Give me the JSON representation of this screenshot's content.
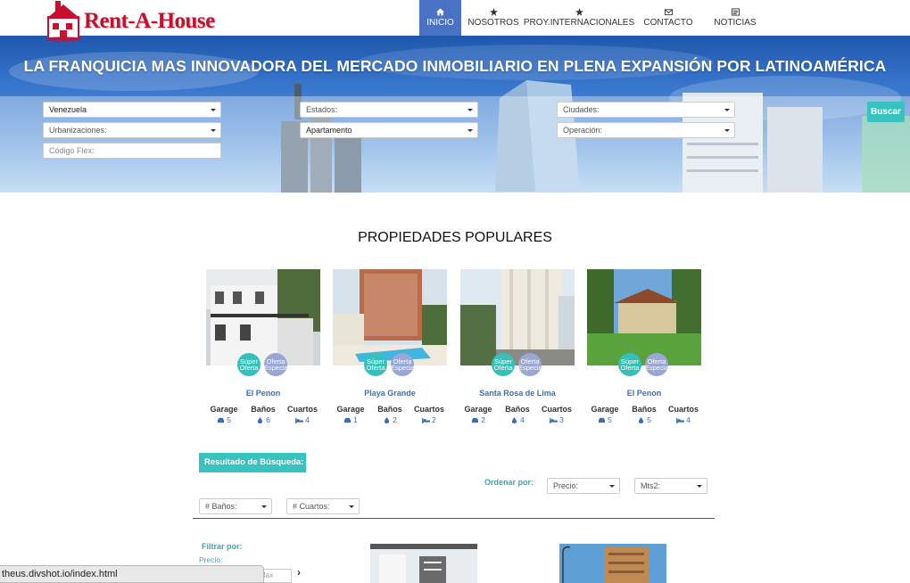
{
  "brand": {
    "name": "Rent-A-House"
  },
  "nav": {
    "items": [
      {
        "label": "INICIO",
        "icon": "home-icon",
        "active": true
      },
      {
        "label": "NOSOTROS",
        "icon": "star-icon"
      },
      {
        "label": "PROY.INTERNACIONALES",
        "icon": "star-icon"
      },
      {
        "label": "CONTACTO",
        "icon": "envelope-icon"
      },
      {
        "label": "NOTICIAS",
        "icon": "newspaper-icon"
      }
    ]
  },
  "hero": {
    "title": "LA FRANQUICIA MAS INNOVADORA DEL MERCADO INMOBILIARIO EN PLENA EXPANSIÓN POR LATINOAMÉRICA"
  },
  "search": {
    "pais": "Venezuela",
    "estados": "Estados:",
    "ciudades": "Ciudades:",
    "urbanizaciones": "Urbanizaciones:",
    "tipo": "Apartamento",
    "operacion": "Operación:",
    "codigo_placeholder": "Código Flex:",
    "button": "Buscar"
  },
  "popular": {
    "title": "PROPIEDADES POPULARES",
    "badge1": "Súper Oferta",
    "badge2": "Oferta Especial",
    "labels": {
      "garage": "Garage",
      "banos": "Baños",
      "cuartos": "Cuartos"
    },
    "cards": [
      {
        "name": "El Penon",
        "garage": "5",
        "banos": "6",
        "cuartos": "4"
      },
      {
        "name": "Playa Grande",
        "garage": "1",
        "banos": "2",
        "cuartos": "2"
      },
      {
        "name": "Santa Rosa de Lima",
        "garage": "2",
        "banos": "4",
        "cuartos": "3"
      },
      {
        "name": "El Penon",
        "garage": "5",
        "banos": "5",
        "cuartos": "4"
      }
    ]
  },
  "results": {
    "title": "Resultado de Búsqueda:",
    "ordenar": "Ordenar por:",
    "precio": "Precio:",
    "mts2": "Mts2:",
    "banos": "# Baños:",
    "cuartos": "# Cuartos:",
    "filtrar": "Filtrar por:",
    "precio_lbl": "Precio:",
    "max_placeholder": "Max",
    "next": "›"
  },
  "statusbar": {
    "url": "theus.divshot.io/index.html"
  },
  "colors": {
    "accent": "#38c3c0",
    "nav_active": "#4a72c4",
    "brand_red": "#c8102e",
    "link": "#3a6eb7"
  }
}
